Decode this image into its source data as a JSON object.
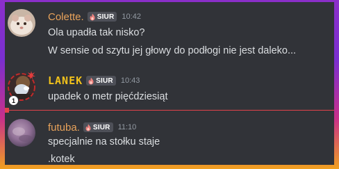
{
  "badge": {
    "label": "SIUR",
    "color": "#4e5058"
  },
  "messages": [
    {
      "username": "Colette.",
      "username_color": "#e8a25a",
      "timestamp": "10:42",
      "lines": [
        "Ola upadła tak nisko?",
        "W sensie od szytu jej głowy do podłogi nie jest daleko..."
      ]
    },
    {
      "username": "LANEK",
      "username_color": "#f2c21b",
      "timestamp": "10:43",
      "lines": [
        "upadek o metr pięćdziesiąt"
      ],
      "avatar_badge": "1"
    },
    {
      "username": "futuba.",
      "username_color": "#e8a25a",
      "timestamp": "11:10",
      "lines": [
        "specjalnie na stołku staje",
        ".kotek"
      ]
    }
  ],
  "new_messages_divider_color": "#e2434a"
}
